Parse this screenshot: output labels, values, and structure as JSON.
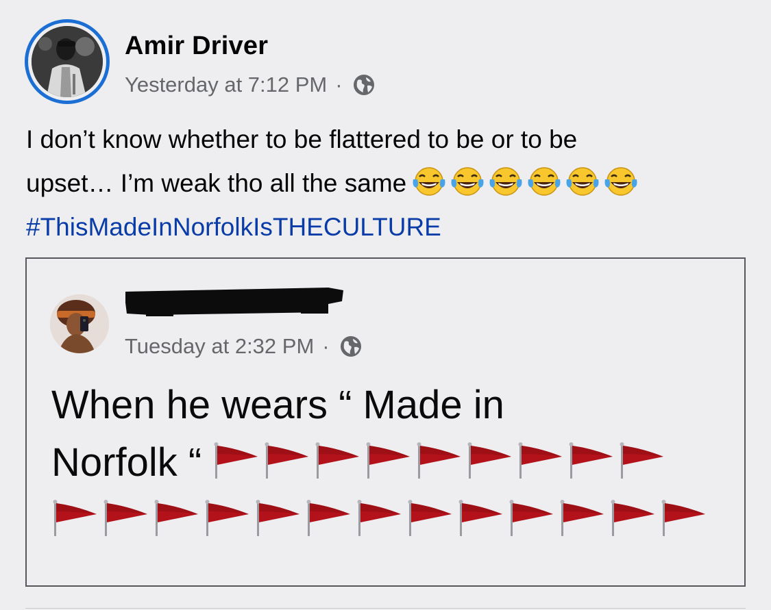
{
  "post": {
    "author_name": "Amir Driver",
    "timestamp": "Yesterday at 7:12 PM",
    "separator": "·",
    "privacy_icon": "globe-icon",
    "text_line1": "I don’t know whether to be flattered to be or to be",
    "text_line2": "upset… I’m weak tho all the same",
    "emoji_name": "face-with-tears-of-joy",
    "emoji_count": 6,
    "hashtag": "#ThisMadeInNorfolkIsTHECULTURE"
  },
  "shared_post": {
    "author_name_redacted": true,
    "timestamp": "Tuesday at 2:32 PM",
    "separator": "·",
    "privacy_icon": "globe-icon",
    "text_line1": "When he wears “ Made in",
    "text_line2": "Norfolk “",
    "flag_emoji_name": "triangular-flag",
    "flags_line2_count": 9,
    "flags_line3_count": 13
  },
  "colors": {
    "background": "#eeeef0",
    "ring": "#1b6fd4",
    "hashtag": "#0a3ca8",
    "meta_text": "#65676b",
    "flag_red": "#b3121b"
  }
}
